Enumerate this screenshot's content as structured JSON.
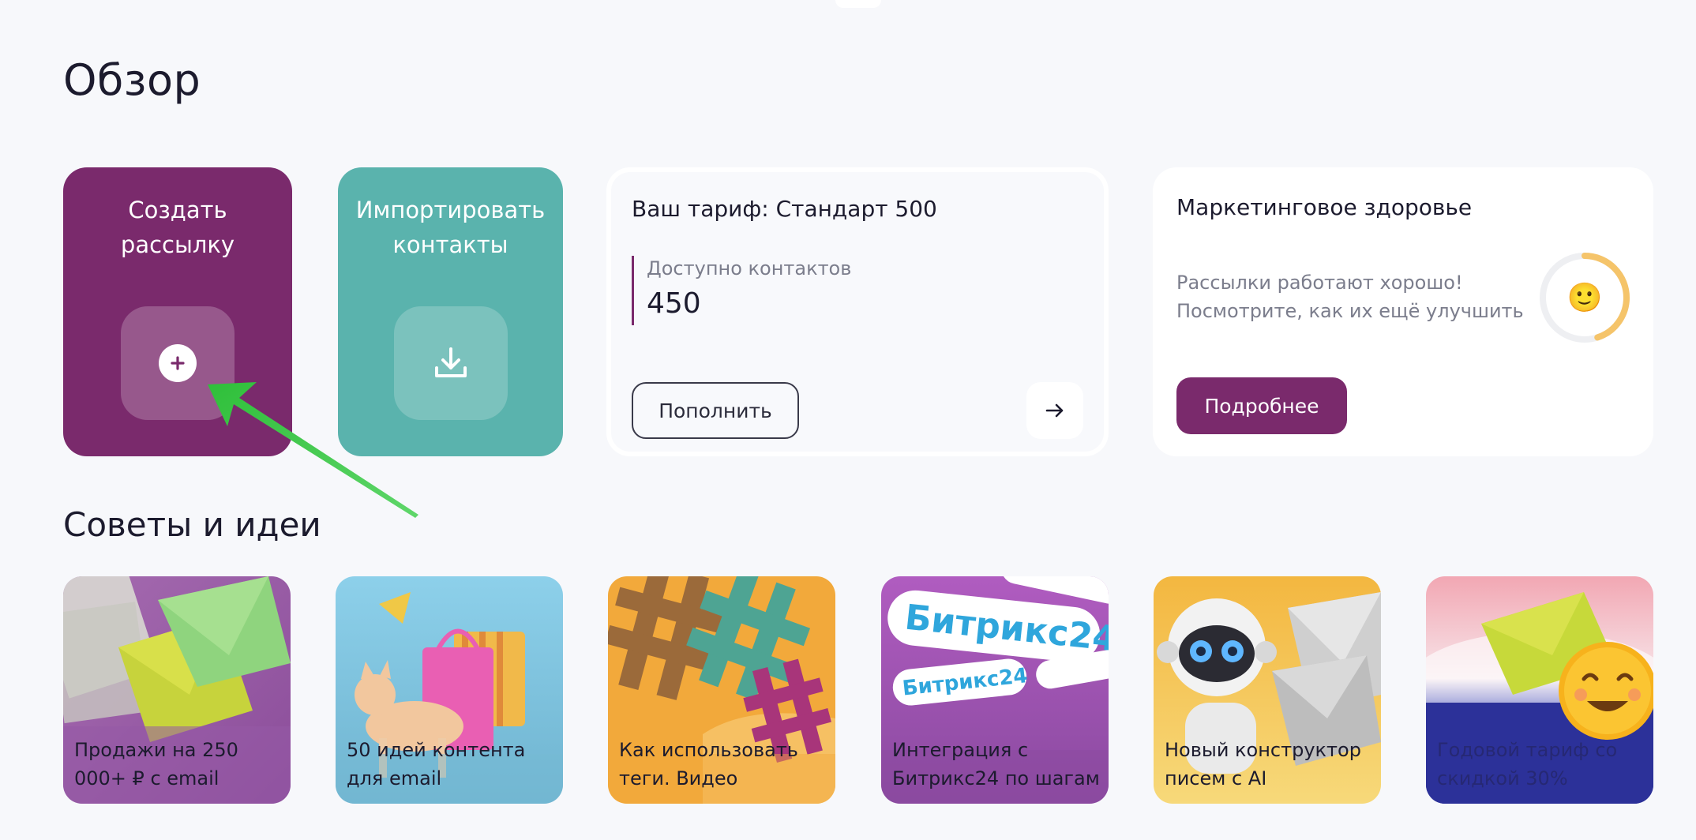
{
  "page": {
    "title": "Обзор"
  },
  "actions": {
    "create_campaign": {
      "label": "Создать рассылку",
      "icon": "plus-circle-icon",
      "color": "#7a2a6c"
    },
    "import_contacts": {
      "label": "Импортировать контакты",
      "icon": "download-icon",
      "color": "#5ab3ad"
    }
  },
  "tariff": {
    "title": "Ваш тариф: Стандарт 500",
    "contacts_label": "Доступно контактов",
    "contacts_value": "450",
    "topup_label": "Пополнить",
    "arrow_icon": "arrow-right-icon"
  },
  "health": {
    "title": "Маркетинговое здоровье",
    "line1": "Рассылки работают хорошо!",
    "line2": "Посмотрите, как их ещё улучшить",
    "gauge_fraction": 0.45,
    "gauge_color": "#f5c46a",
    "emoji": "🙂",
    "details_label": "Подробнее"
  },
  "tips": {
    "title": "Советы и идеи",
    "items": [
      {
        "label": "Продажи на 250 000+ ₽ с email"
      },
      {
        "label": "50 идей контента для email"
      },
      {
        "label": "Как использовать теги. Видео"
      },
      {
        "label": "Интеграция с Битрикс24 по шагам",
        "logo_text": "Битрикс24"
      },
      {
        "label": "Новый конструктор писем с AI"
      },
      {
        "label": "Годовой тариф со скидкой 30%"
      }
    ]
  }
}
